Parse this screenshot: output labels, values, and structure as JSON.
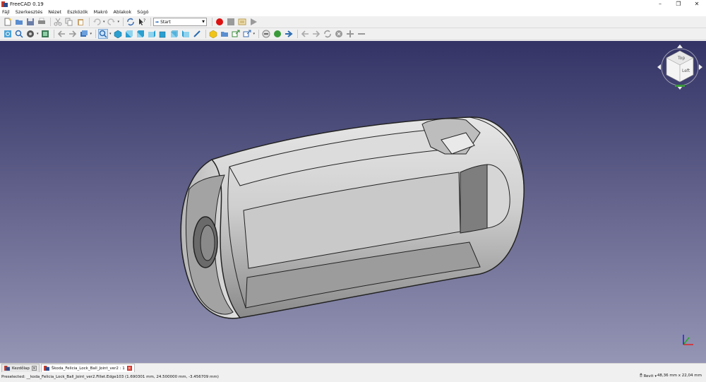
{
  "window": {
    "title": "FreeCAD 0.19"
  },
  "menu": [
    "Fájl",
    "Szerkesztés",
    "Nézet",
    "Eszközök",
    "Makró",
    "Ablakok",
    "Súgó"
  ],
  "toolbar": {
    "workbench": "Start"
  },
  "navcube": {
    "top_label": "Top",
    "left_label": "Left"
  },
  "tabs": [
    {
      "label": "Kezdőlap"
    },
    {
      "label": "Škoda_Felicia_Lock_Ball_Joint_ver2 : 1"
    }
  ],
  "status": {
    "text": "Preselected: __koda_Felicia_Lock_Ball_Joint_ver2.Fillet.Edge103 (1.690301 mm, 24.500000 mm, -3.456709 mm)",
    "nav_style": "Revit",
    "dimensions": "48,36 mm x 22,04 mm"
  },
  "colors": {
    "viewport_top": "#333366",
    "viewport_bottom": "#9595b5",
    "record": "#dd1111"
  },
  "icons": [
    "new-icon",
    "open-icon",
    "save-icon",
    "print-icon",
    "cut-icon",
    "copy-icon",
    "paste-icon",
    "undo-icon",
    "redo-icon",
    "refresh-icon",
    "whats-this-icon",
    "record-macro-icon",
    "stop-macro-icon",
    "edit-macro-icon",
    "run-macro-icon"
  ]
}
